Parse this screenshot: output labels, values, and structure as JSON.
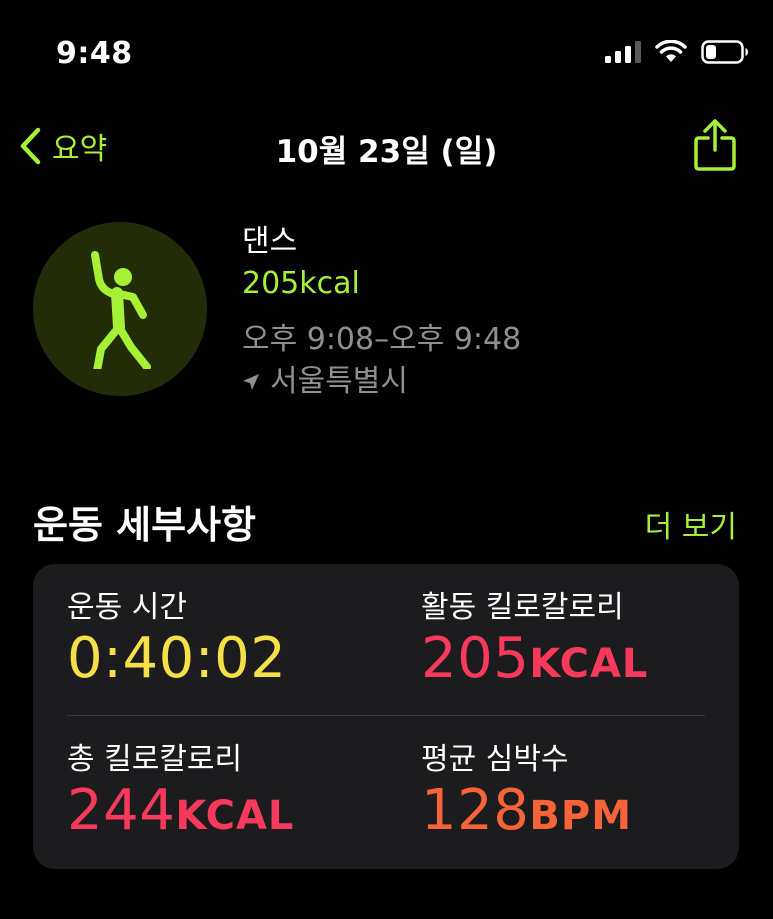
{
  "status_bar": {
    "time": "9:48",
    "icons": [
      "cellular-signal-icon",
      "wifi-icon",
      "battery-icon"
    ]
  },
  "nav": {
    "back_label": "요약",
    "title": "10월 23일 (일)",
    "share_icon": "share-icon"
  },
  "workout": {
    "icon": "dance-icon",
    "name": "댄스",
    "calories": "205kcal",
    "time_range": "오후 9:08–오후 9:48",
    "location": "서울특별시"
  },
  "details": {
    "title": "운동 세부사항",
    "more_label": "더 보기",
    "metrics": [
      {
        "label": "운동 시간",
        "value": "0:40:02",
        "unit": "",
        "color": "#f5e04a"
      },
      {
        "label": "활동 킬로칼로리",
        "value": "205",
        "unit": "KCAL",
        "color": "#f73a5c"
      },
      {
        "label": "총 킬로칼로리",
        "value": "244",
        "unit": "KCAL",
        "color": "#f73a5c"
      },
      {
        "label": "평균 심박수",
        "value": "128",
        "unit": "BPM",
        "color": "#f76339"
      }
    ]
  },
  "colors": {
    "accent_green": "#a6f035",
    "secondary_text": "#8e8e93",
    "card_background": "#1c1c1e"
  }
}
